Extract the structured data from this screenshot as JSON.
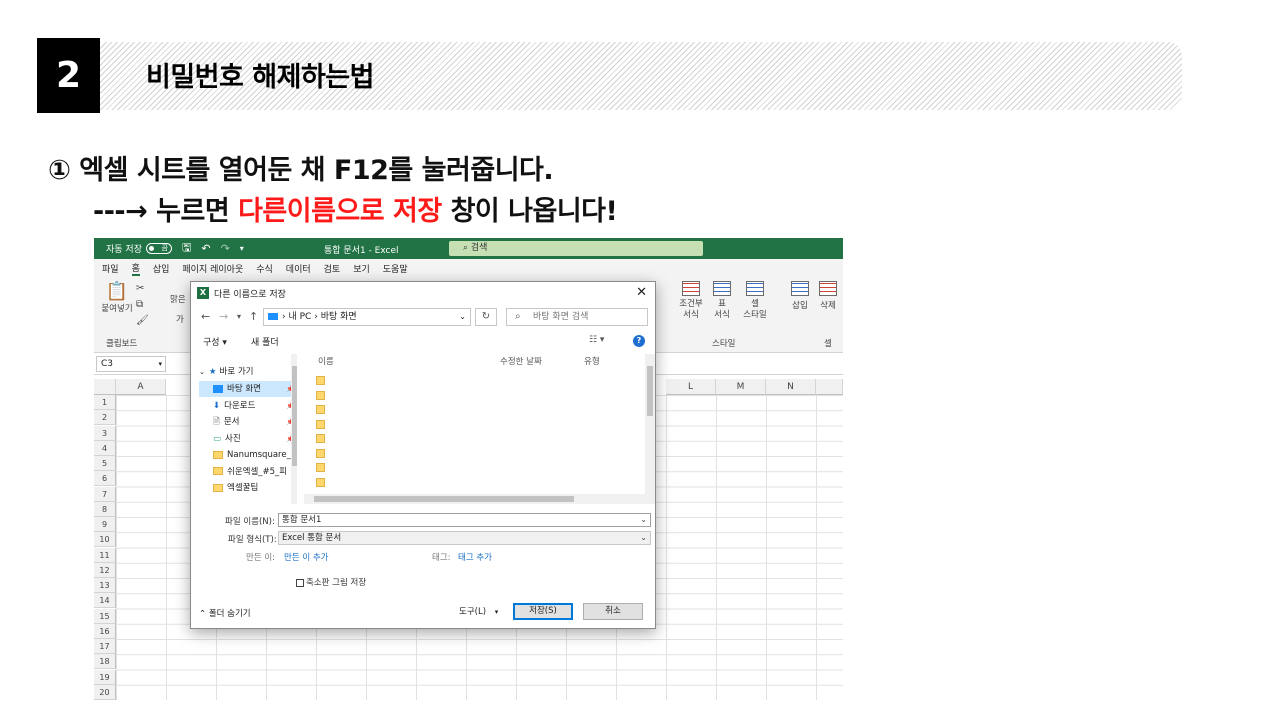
{
  "header": {
    "step": "2",
    "title": "비밀번호 해제하는법"
  },
  "instructions": {
    "line1": "① 엑셀 시트를 열어둔 채 F12를 눌러줍니다.",
    "line2_prefix": "---→ 누르면 ",
    "line2_highlight": "다른이름으로 저장",
    "line2_suffix": " 창이 나옵니다!",
    "highlight_color": "#ff1a1a"
  },
  "excel": {
    "titlebar": {
      "autosave_label": "자동 저장",
      "toggle_state": "끔",
      "document_title": "통합 문서1 - Excel",
      "search_placeholder": "검색"
    },
    "tabs": [
      "파일",
      "홈",
      "삽입",
      "페이지 레이아웃",
      "수식",
      "데이터",
      "검토",
      "보기",
      "도움말"
    ],
    "active_tab": "홈",
    "ribbon": {
      "paste": "붙여넣기",
      "clipboard_group": "클립보드",
      "font_partial": "맑은",
      "font_char": "가",
      "conditional_format": "조건부\n서식",
      "format_table": "표\n서식",
      "cell_style": "셀\n스타일",
      "styles_group": "스타일",
      "insert": "삽입",
      "delete": "삭제",
      "cells_group": "셀"
    },
    "namebox": "C3",
    "columns_left": [
      "A"
    ],
    "columns_right": [
      "L",
      "M",
      "N"
    ],
    "rows": [
      "1",
      "2",
      "3",
      "4",
      "5",
      "6",
      "7",
      "8",
      "9",
      "10",
      "11",
      "12",
      "13",
      "14",
      "15",
      "16",
      "17",
      "18",
      "19",
      "20"
    ],
    "accent_color": "#217346"
  },
  "dialog": {
    "title": "다른 이름으로 저장",
    "breadcrumb": [
      "내 PC",
      "바탕 화면"
    ],
    "search_placeholder": "바탕 화면 검색",
    "organize": "구성 ▾",
    "new_folder": "새 폴더",
    "quick_access": "바로 가기",
    "nav_items": [
      {
        "label": "바탕 화면",
        "pinned": true,
        "icon": "desktop-icon"
      },
      {
        "label": "다운로드",
        "pinned": true,
        "icon": "download-icon"
      },
      {
        "label": "문서",
        "pinned": true,
        "icon": "document-icon"
      },
      {
        "label": "사진",
        "pinned": true,
        "icon": "picture-icon"
      },
      {
        "label": "Nanumsquare_a",
        "pinned": false,
        "icon": "folder-icon"
      },
      {
        "label": "쉬운엑셀_#5_피",
        "pinned": false,
        "icon": "folder-icon"
      },
      {
        "label": "엑셀꿀팁",
        "pinned": false,
        "icon": "folder-icon"
      }
    ],
    "columns": [
      "이름",
      "수정한 날짜",
      "유형"
    ],
    "file_name_label": "파일 이름(N):",
    "file_name_value": "통합 문서1",
    "file_type_label": "파일 형식(T):",
    "file_type_value": "Excel 통합 문서",
    "author_label": "만든 이:",
    "author_link": "만든 이 추가",
    "tags_label": "태그:",
    "tags_link": "태그 추가",
    "thumbnail_checkbox": "축소판 그림 저장",
    "hide_folders": "폴더 숨기기",
    "tools": "도구(L)",
    "save_button": "저장(S)",
    "cancel_button": "취소"
  }
}
